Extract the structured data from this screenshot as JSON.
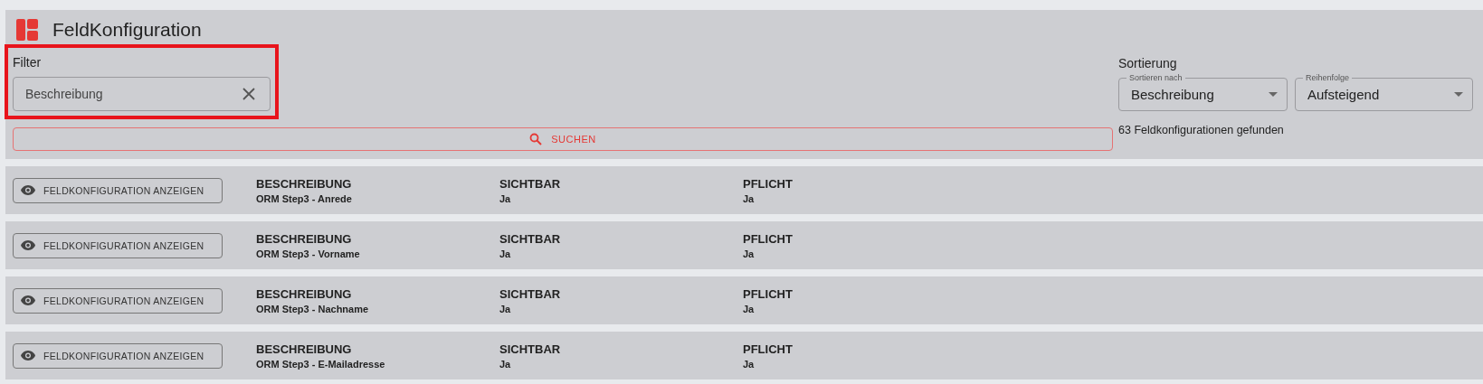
{
  "header": {
    "title": "FeldKonfiguration"
  },
  "filter": {
    "label": "Filter",
    "value": "Beschreibung",
    "highlighted": true
  },
  "search_button": {
    "label": "SUCHEN"
  },
  "sorting": {
    "label": "Sortierung",
    "sort_by": {
      "label": "Sortieren nach",
      "value": "Beschreibung"
    },
    "order": {
      "label": "Reihenfolge",
      "value": "Aufsteigend"
    }
  },
  "result_count": "63 Feldkonfigurationen gefunden",
  "rows": [
    {
      "button": "FELDKONFIGURATION ANZEIGEN",
      "fields": [
        {
          "label": "BESCHREIBUNG",
          "value": "ORM Step3 - Anrede"
        },
        {
          "label": "SICHTBAR",
          "value": "Ja"
        },
        {
          "label": "PFLICHT",
          "value": "Ja"
        }
      ]
    },
    {
      "button": "FELDKONFIGURATION ANZEIGEN",
      "fields": [
        {
          "label": "BESCHREIBUNG",
          "value": "ORM Step3 - Vorname"
        },
        {
          "label": "SICHTBAR",
          "value": "Ja"
        },
        {
          "label": "PFLICHT",
          "value": "Ja"
        }
      ]
    },
    {
      "button": "FELDKONFIGURATION ANZEIGEN",
      "fields": [
        {
          "label": "BESCHREIBUNG",
          "value": "ORM Step3 - Nachname"
        },
        {
          "label": "SICHTBAR",
          "value": "Ja"
        },
        {
          "label": "PFLICHT",
          "value": "Ja"
        }
      ]
    },
    {
      "button": "FELDKONFIGURATION ANZEIGEN",
      "fields": [
        {
          "label": "BESCHREIBUNG",
          "value": "ORM Step3 - E-Mailadresse"
        },
        {
          "label": "SICHTBAR",
          "value": "Ja"
        },
        {
          "label": "PFLICHT",
          "value": "Ja"
        }
      ]
    }
  ]
}
